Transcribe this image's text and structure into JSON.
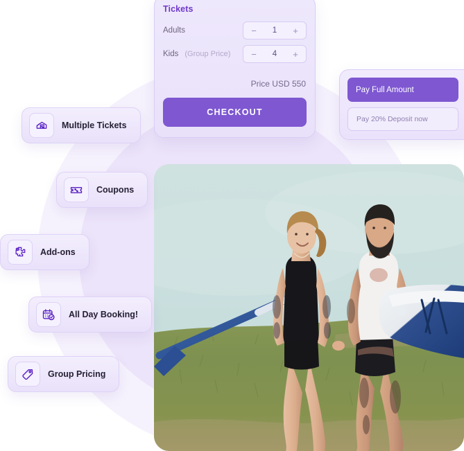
{
  "colors": {
    "brand_purple": "#7e57d1",
    "card_bg": "#ebe3fb",
    "ring_outer": "#f6f2fd",
    "ring_inner": "#ece4fa",
    "title_purple": "#6f39c9",
    "muted_text": "#8c7fb0"
  },
  "tickets_card": {
    "title": "Tickets",
    "rows": [
      {
        "label": "Adults",
        "sublabel": "",
        "minus": "−",
        "value": "1",
        "plus": "+"
      },
      {
        "label": "Kids",
        "sublabel": "(Group Price)",
        "minus": "−",
        "value": "4",
        "plus": "+"
      }
    ],
    "price_line": "Price USD 550",
    "checkout_label": "CHECKOUT"
  },
  "payment_card": {
    "primary_label": "Pay Full Amount",
    "secondary_label": "Pay 20% Deposit now"
  },
  "features": [
    {
      "label": "Multiple Tickets",
      "icon": "tickets-icon"
    },
    {
      "label": "Coupons",
      "icon": "coupon-percent-icon"
    },
    {
      "label": "Add-ons",
      "icon": "puzzle-piece-icon"
    },
    {
      "label": "All Day Booking!",
      "icon": "calendar-check-icon"
    },
    {
      "label": "Group Pricing",
      "icon": "price-tag-icon"
    }
  ],
  "photo": {
    "alt": "Couple walking on grass by a lake carrying a stand-up paddleboard and paddle"
  }
}
